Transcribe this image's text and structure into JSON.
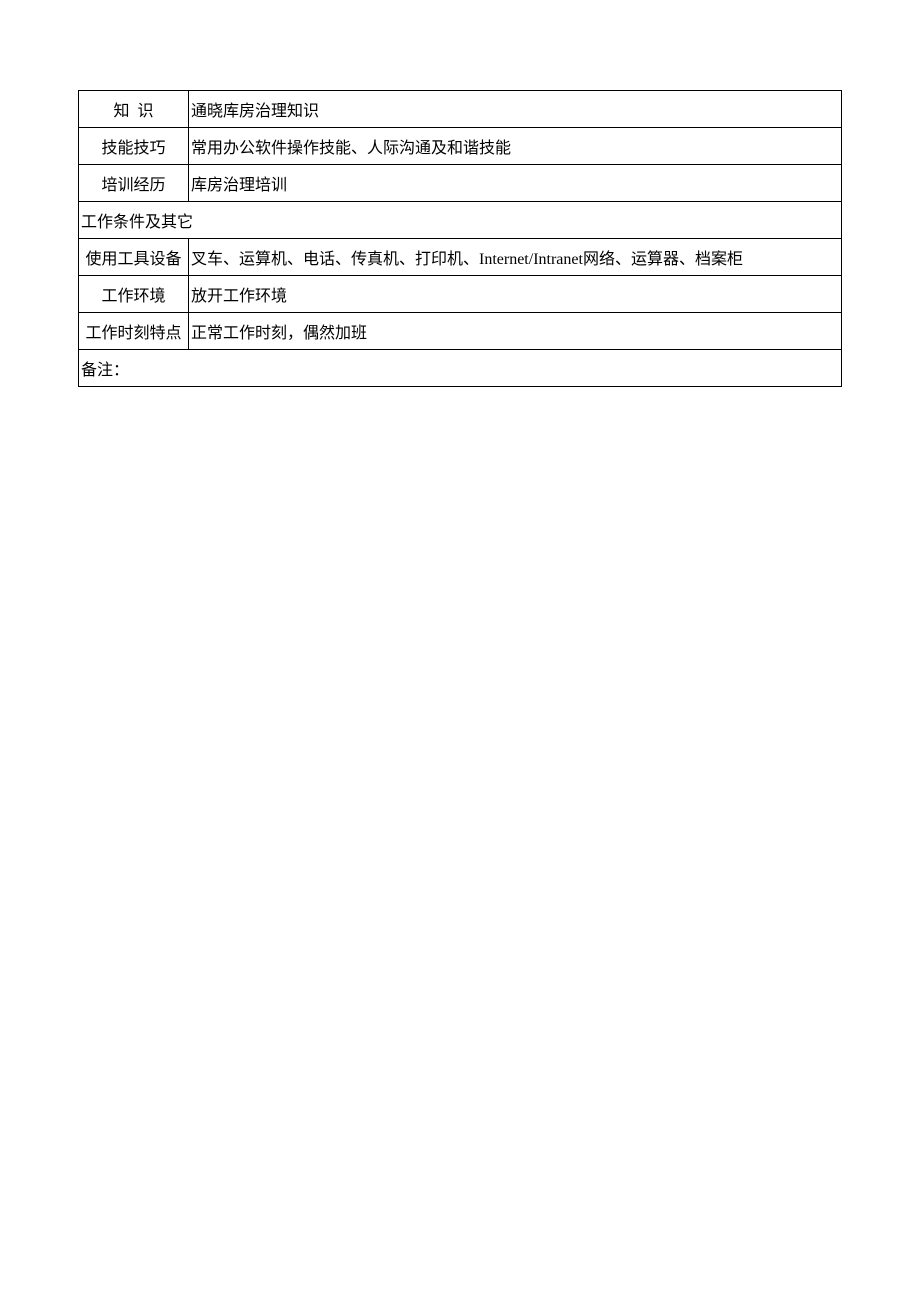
{
  "rows": {
    "knowledge": {
      "label": "知识",
      "value": "通晓库房治理知识"
    },
    "skills": {
      "label": "技能技巧",
      "value": "常用办公软件操作技能、人际沟通及和谐技能"
    },
    "training": {
      "label": "培训经历",
      "value": "库房治理培训"
    },
    "section_header": "工作条件及其它",
    "tools": {
      "label": "使用工具设备",
      "value": "叉车、运算机、电话、传真机、打印机、Internet/Intranet网络、运算器、档案柜"
    },
    "environment": {
      "label": "工作环境",
      "value": "放开工作环境"
    },
    "schedule": {
      "label": "工作时刻特点",
      "value": "正常工作时刻，偶然加班"
    },
    "remarks": "备注："
  }
}
